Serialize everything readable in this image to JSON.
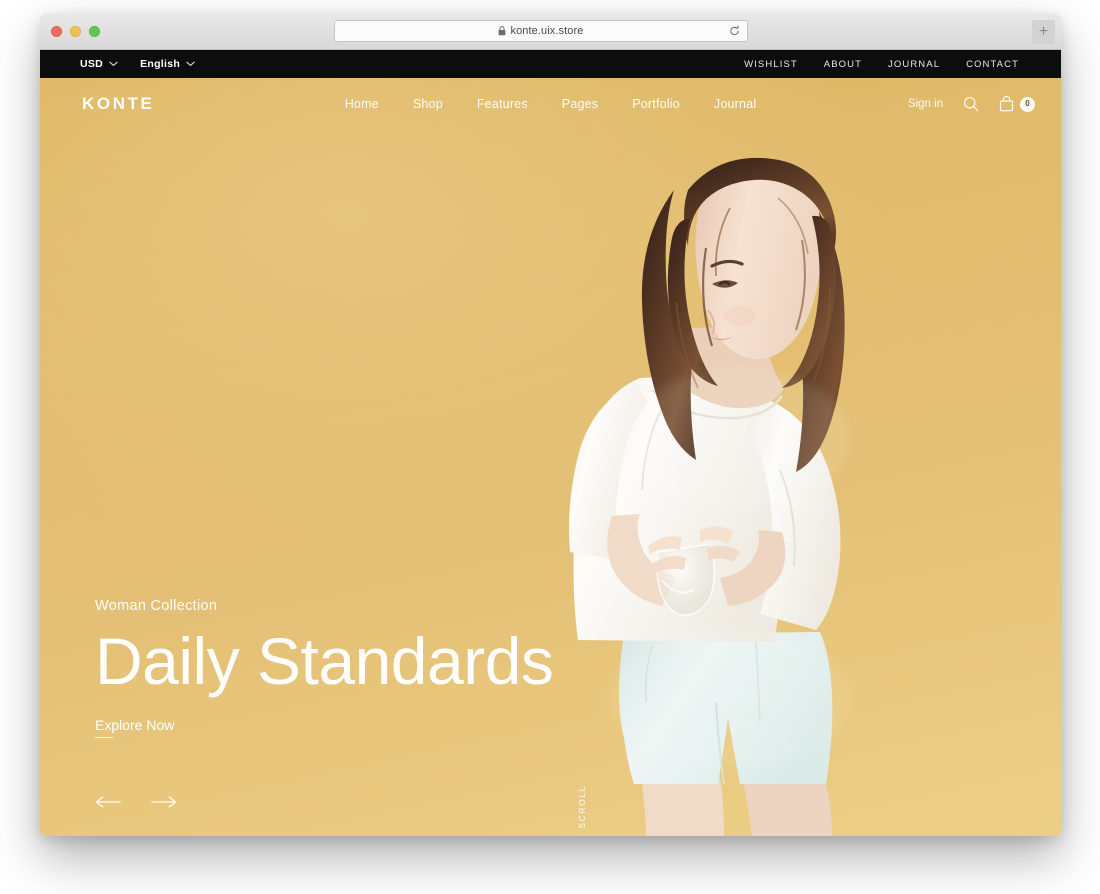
{
  "browser": {
    "url": "konte.uix.store",
    "lock_icon": "lock-icon",
    "reload_icon": "reload-icon",
    "new_tab_label": "+",
    "traffic_lights": [
      "close",
      "minimize",
      "maximize"
    ]
  },
  "topbar": {
    "currency": {
      "label": "USD",
      "icon": "chevron-down-icon"
    },
    "language": {
      "label": "English",
      "icon": "chevron-down-icon"
    },
    "links": [
      "WISHLIST",
      "ABOUT",
      "JOURNAL",
      "CONTACT"
    ]
  },
  "header": {
    "logo": "KONTE",
    "nav": [
      "Home",
      "Shop",
      "Features",
      "Pages",
      "Portfolio",
      "Journal"
    ],
    "signin_label": "Sign in",
    "search_icon": "search-icon",
    "bag_icon": "shopping-bag-icon",
    "cart_count": "0"
  },
  "hero": {
    "eyebrow": "Woman Collection",
    "title": "Daily Standards",
    "cta": "Explore Now",
    "prev_icon": "arrow-left-icon",
    "next_icon": "arrow-right-icon",
    "scroll_label": "SCROLL"
  },
  "colors": {
    "topbar_bg": "#0d0d0d",
    "hero_bg": "#e4c076",
    "hero_bg_dark": "#ddb45f",
    "hero_bg_light": "#eccf86",
    "text_on_hero": "#ffffff",
    "garment_top": "#fbfaf7",
    "garment_shorts": "#e2eeec",
    "hair": "#4a3024",
    "skin": "#f3ddcd"
  }
}
